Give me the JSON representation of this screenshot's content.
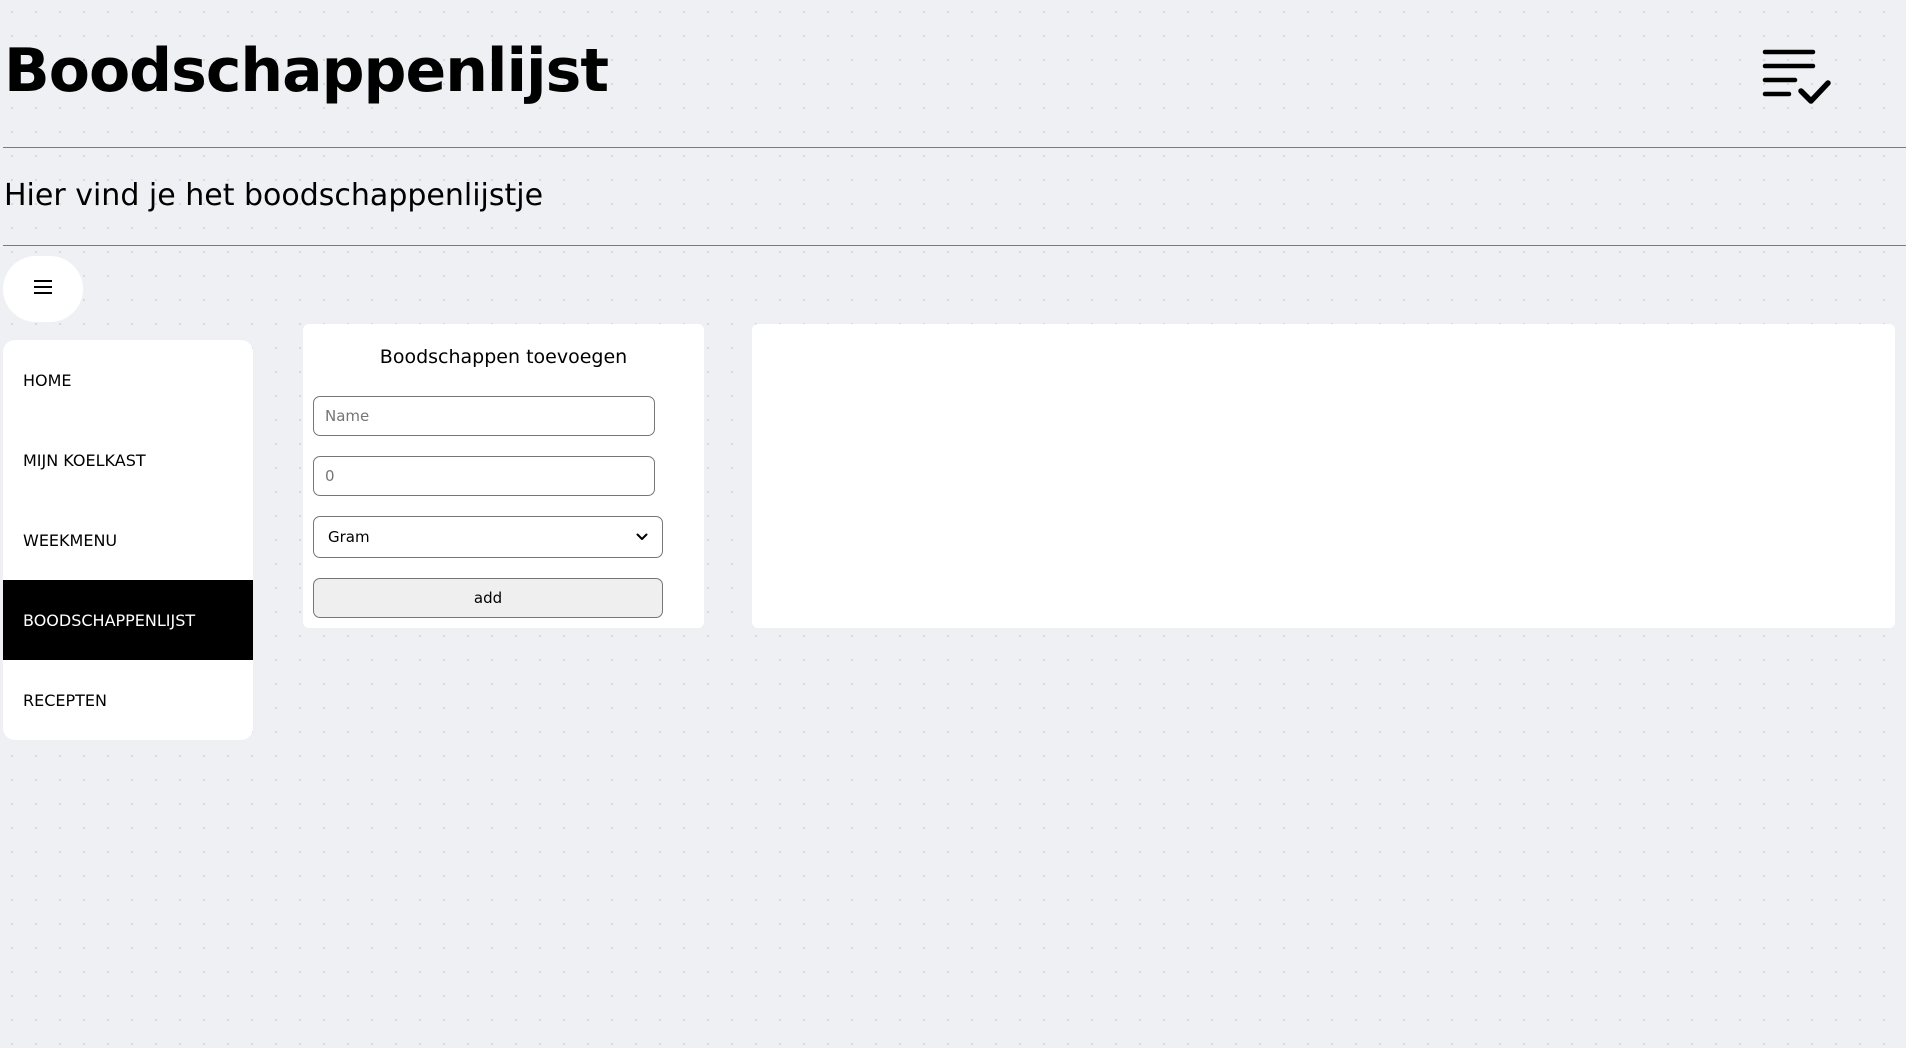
{
  "header": {
    "title": "Boodschappenlijst",
    "icon": "checklist-icon"
  },
  "subtitle": "Hier vind je het boodschappenlijstje",
  "menu_toggle": {
    "icon": "hamburger-menu-icon"
  },
  "sidebar": {
    "items": [
      {
        "label": "HOME",
        "active": false
      },
      {
        "label": "MIJN KOELKAST",
        "active": false
      },
      {
        "label": "WEEKMENU",
        "active": false
      },
      {
        "label": "BOODSCHAPPENLIJST",
        "active": true
      },
      {
        "label": "RECEPTEN",
        "active": false
      }
    ]
  },
  "add_form": {
    "title": "Boodschappen toevoegen",
    "name_placeholder": "Name",
    "quantity_placeholder": "0",
    "unit_selected": "Gram",
    "add_label": "add"
  },
  "shopping_list": {
    "items": []
  },
  "colors": {
    "background": "#eff0f4",
    "card": "#ffffff",
    "active_nav_bg": "#000000",
    "active_nav_text": "#ffffff",
    "divider": "#7b7b7b",
    "button_bg": "#efefef"
  }
}
